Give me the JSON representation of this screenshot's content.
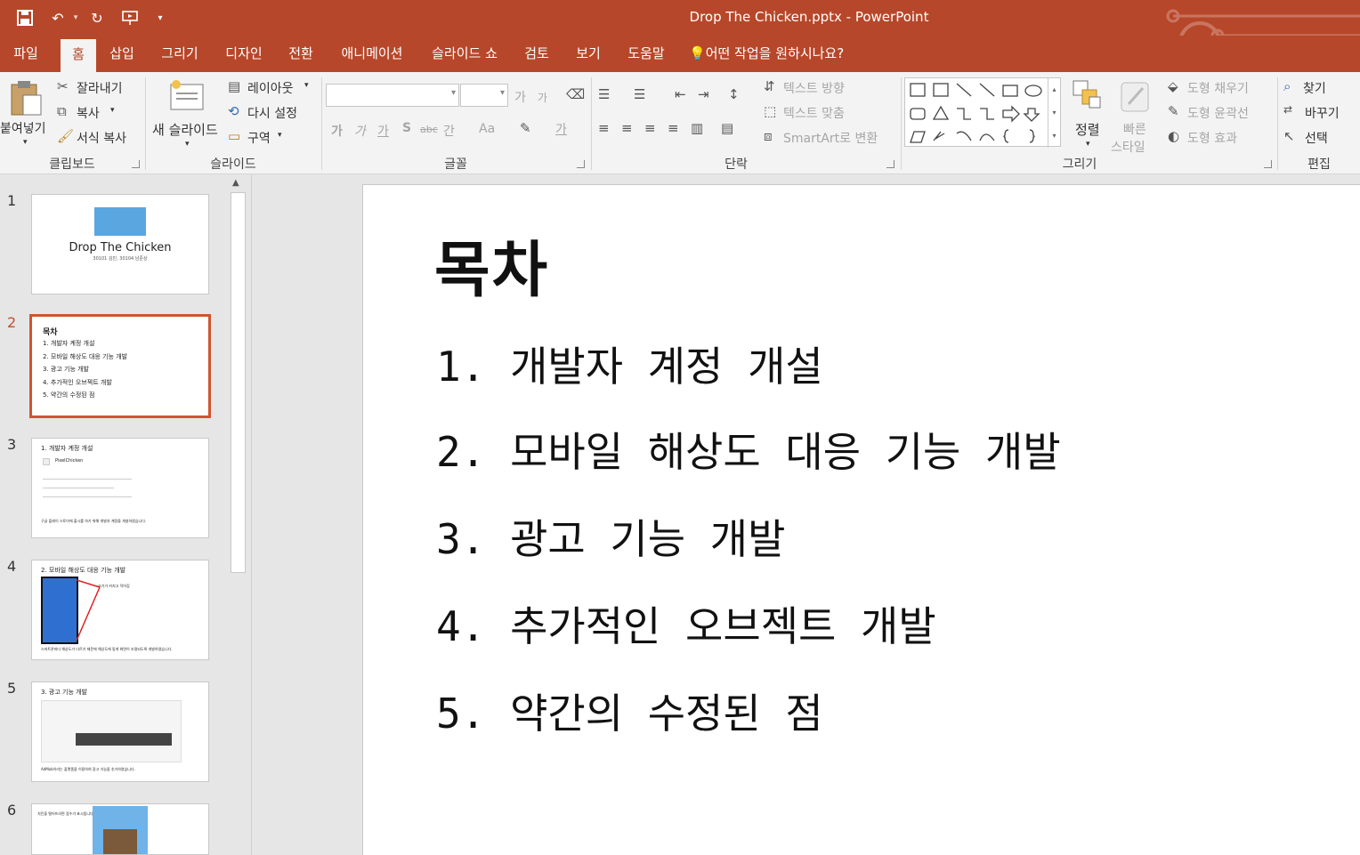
{
  "window": {
    "doc_title": "Drop The Chicken.pptx  -  PowerPoint"
  },
  "tabs": [
    "파일",
    "홈",
    "삽입",
    "그리기",
    "디자인",
    "전환",
    "애니메이션",
    "슬라이드 쇼",
    "검토",
    "보기",
    "도움말"
  ],
  "tell_me": "어떤 작업을 원하시나요?",
  "ribbon": {
    "clipboard": {
      "paste": "붙여넣기",
      "cut": "잘라내기",
      "copy": "복사",
      "format_painter": "서식 복사",
      "label": "클립보드"
    },
    "slides": {
      "new_slide": "새 슬라이드",
      "layout": "레이아웃",
      "reset": "다시 설정",
      "section": "구역",
      "label": "슬라이드"
    },
    "font": {
      "label": "글꼴",
      "size_up": "가",
      "size_down": "가",
      "bold": "가",
      "italic": "가",
      "underline": "가",
      "shadow": "S",
      "strike": "abc",
      "spacing": "간",
      "case": "Aa",
      "font_color": "가"
    },
    "paragraph": {
      "label": "단락",
      "text_direction": "텍스트 방향",
      "align_text": "텍스트 맞춤",
      "smartart": "SmartArt로 변환"
    },
    "drawing": {
      "label": "그리기",
      "arrange": "정렬",
      "quick_styles_1": "빠른",
      "quick_styles_2": "스타일",
      "fill": "도형 채우기",
      "outline": "도형 윤곽선",
      "effects": "도형 효과"
    },
    "editing": {
      "label": "편집",
      "find": "찾기",
      "replace": "바꾸기",
      "select": "선택"
    }
  },
  "thumbs": [
    {
      "num": "1",
      "title": "Drop The Chicken",
      "subtitle": "30101 김민, 30104 남준상"
    },
    {
      "num": "2",
      "title": "목차",
      "items": [
        "1. 개발자 계정 개설",
        "2. 모바일 해상도 대응 기능 개발",
        "3. 광고 기능 개발",
        "4. 추가적인 오브젝트 개발",
        "5. 약간의 수정된 점"
      ]
    },
    {
      "num": "3",
      "title": "1. 개발자 계정 개설",
      "app": "PixelChicken",
      "caption": "구글 플레이 스토어에 출시를 하기 위해 개발자 계정을 개설하였습니다."
    },
    {
      "num": "4",
      "title": "2. 모바일 해상도 대응 기능 개발",
      "note": "크기가 커지고 작아짐",
      "caption": "스마트폰마다 해상도가 다르기 때문에 해상도에 맞게 화면이 조절되도록 개발하였습니다."
    },
    {
      "num": "5",
      "title": "3. 광고 기능 개발",
      "caption": "AdMob이라는 플랫폼을 이용하여 광고 기능을 추가하였습니다."
    },
    {
      "num": "6",
      "caption": "치킨을 떨어뜨리면 점수가 표시됩니다."
    }
  ],
  "slide": {
    "title": "목차",
    "items": [
      "1. 개발자 계정 개설",
      "2. 모바일 해상도 대응 기능 개발",
      "3. 광고 기능 개발",
      "4. 추가적인 오브젝트 개발",
      "5. 약간의 수정된 점"
    ]
  },
  "colors": {
    "accent": "#b7472a",
    "selection": "#d0552f"
  }
}
